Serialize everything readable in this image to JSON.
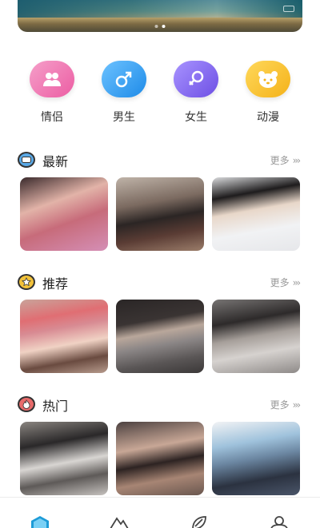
{
  "banner": {
    "dot_count": 2,
    "active_dot": 1
  },
  "categories": [
    {
      "label": "情侣",
      "icon": "couple-icon",
      "color": "#f17bb4"
    },
    {
      "label": "男生",
      "icon": "male-symbol-icon",
      "color": "#3aa4f3"
    },
    {
      "label": "女生",
      "icon": "female-symbol-icon",
      "color": "#8b6ff0"
    },
    {
      "label": "动漫",
      "icon": "bear-face-icon",
      "color": "#f6c22e"
    }
  ],
  "sections": [
    {
      "title": "最新",
      "more": "更多",
      "icon": "new-badge-icon",
      "icon_color": "#5aa9e6"
    },
    {
      "title": "推荐",
      "more": "更多",
      "icon": "star-icon",
      "icon_color": "#f2c23a"
    },
    {
      "title": "热门",
      "more": "更多",
      "icon": "flame-icon",
      "icon_color": "#e86b6b"
    }
  ],
  "tabs": [
    {
      "name": "home",
      "icon": "home-hexagon-icon",
      "active": true
    },
    {
      "name": "discover",
      "icon": "mountain-icon",
      "active": false
    },
    {
      "name": "explore",
      "icon": "leaf-icon",
      "active": false
    },
    {
      "name": "profile",
      "icon": "person-icon",
      "active": false
    }
  ],
  "colors": {
    "accent": "#1d9bd7",
    "muted": "#999999"
  }
}
